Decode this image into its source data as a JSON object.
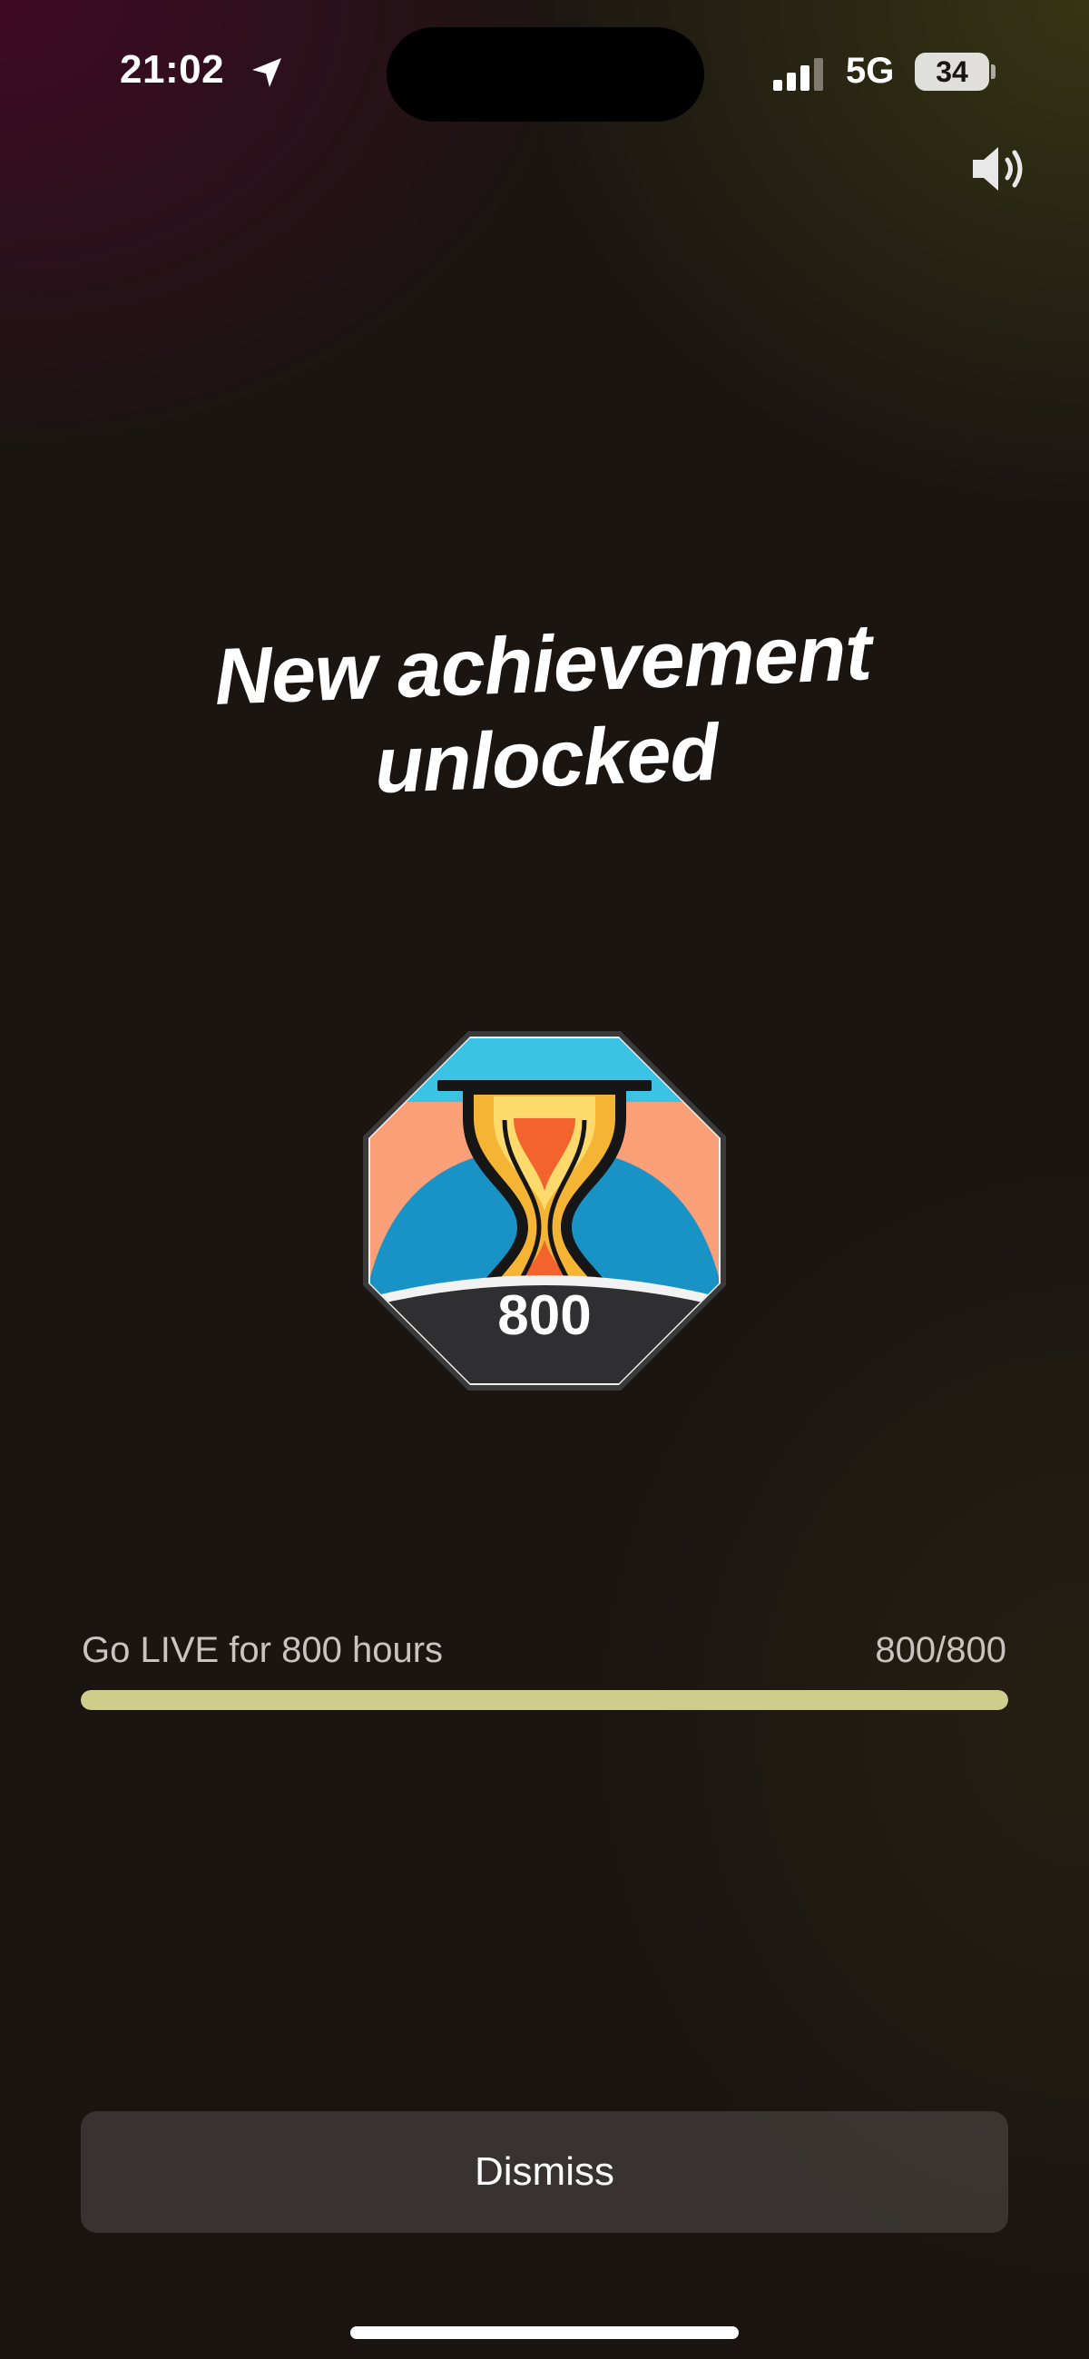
{
  "status_bar": {
    "time": "21:02",
    "network": "5G",
    "battery": "34",
    "icons": [
      "location-arrow-icon",
      "cellular-signal-icon",
      "battery-icon"
    ]
  },
  "sound_button": {
    "icon": "speaker-icon"
  },
  "achievement": {
    "title": "New achievement unlocked",
    "badge_value": "800",
    "badge_icon": "hourglass-icon"
  },
  "goal": {
    "label": "Go LIVE for 800 hours",
    "count": "800/800",
    "progress": 1.0,
    "progress_color": "#cfcd8c"
  },
  "dismiss_label": "Dismiss"
}
